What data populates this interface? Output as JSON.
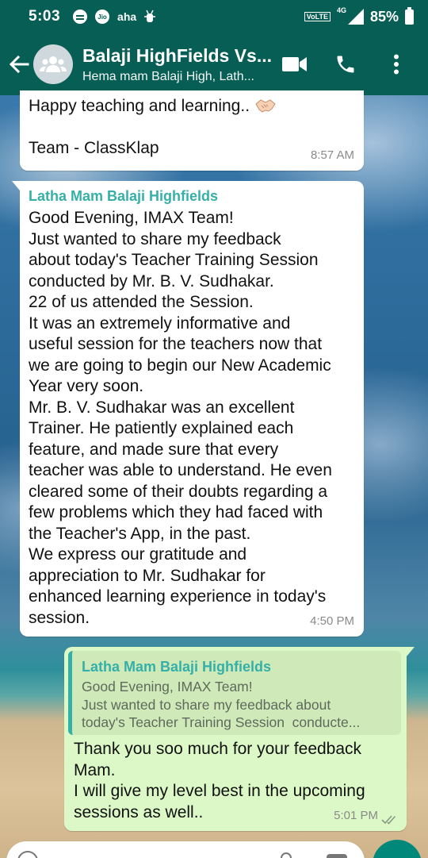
{
  "status_bar": {
    "time": "5:03",
    "app_label": "aha",
    "jio": "Jio",
    "volte": "VoLTE",
    "network": "4G",
    "battery": "85%"
  },
  "header": {
    "title": "Balaji HighFields Vs...",
    "subtitle": "Hema mam Balaji High, Lath..."
  },
  "messages": [
    {
      "lines": [
        "Happy teaching and learning.."
      ],
      "signature": "Team - ClassKlap",
      "time": "8:57 AM"
    },
    {
      "sender": "Latha Mam Balaji Highfields",
      "text": "Good Evening, IMAX Team!\nJust wanted to share my feedback\nabout today's Teacher Training Session\nconducted by Mr. B. V. Sudhakar.\n22 of us attended the Session.\nIt was an extremely informative and\nuseful session for the teachers now that\nwe are going to begin our New Academic\nYear very soon.\nMr. B. V. Sudhakar was an excellent\nTrainer. He patiently explained each\nfeature, and made sure that every\nteacher was able to understand. He even\ncleared some of their doubts regarding a\nfew problems which they had faced with\nthe Teacher's App, in the past.\nWe express our gratitude and\nappreciation to Mr. Sudhakar for\nenhanced learning experience in today's\nsession.",
      "time": "4:50 PM"
    },
    {
      "quoted_sender": "Latha Mam Balaji Highfields",
      "quoted_text": "Good Evening, IMAX Team!\nJust wanted to share my feedback about\ntoday's Teacher Training Session  conducte...",
      "text": "Thank you soo much for your feedback\nMam.\nI will give my level best in the upcoming\nsessions as well..",
      "time": "5:01 PM"
    }
  ],
  "colors": {
    "header": "#075e54",
    "sender_name": "#35b0a8",
    "outgoing_bubble": "#dcf8c6"
  }
}
